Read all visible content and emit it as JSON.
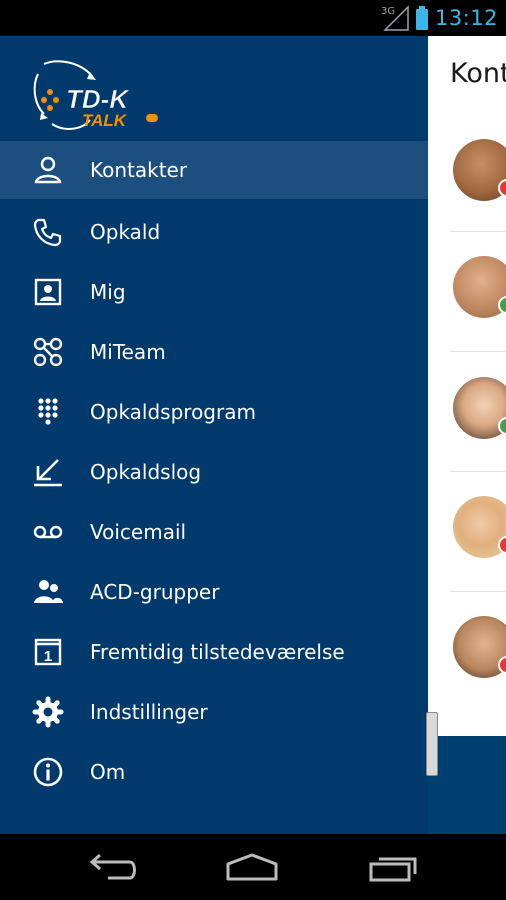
{
  "status_bar": {
    "network": "3G",
    "time": "13:12",
    "accent": "#3db5e6"
  },
  "logo": {
    "line1": "TD-K",
    "line2": "TALK"
  },
  "drawer": {
    "background": "#003a6d",
    "items": [
      {
        "label": "Kontakter",
        "icon": "person-icon",
        "selected": true
      },
      {
        "label": "Opkald",
        "icon": "phone-icon"
      },
      {
        "label": "Mig",
        "icon": "contact-card-icon"
      },
      {
        "label": "MiTeam",
        "icon": "team-nodes-icon"
      },
      {
        "label": "Opkaldsprogram",
        "icon": "dialpad-icon"
      },
      {
        "label": "Opkaldslog",
        "icon": "call-log-icon"
      },
      {
        "label": "Voicemail",
        "icon": "voicemail-icon"
      },
      {
        "label": "ACD-grupper",
        "icon": "group-icon"
      },
      {
        "label": "Fremtidig tilstedeværelse",
        "icon": "calendar-icon"
      },
      {
        "label": "Indstillinger",
        "icon": "gear-icon"
      },
      {
        "label": "Om",
        "icon": "info-icon"
      }
    ]
  },
  "contacts": {
    "title": "Kont",
    "rows": [
      {
        "avatar": "avatar-man-1",
        "status": "busy",
        "status_color": "#e53935"
      },
      {
        "avatar": "avatar-man-2",
        "status": "available",
        "status_color": "#43a047"
      },
      {
        "avatar": "avatar-woman-1",
        "status": "available",
        "status_color": "#43a047"
      },
      {
        "avatar": "avatar-woman-2",
        "status": "busy",
        "status_color": "#e53935"
      },
      {
        "avatar": "avatar-man-3",
        "status": "busy",
        "status_color": "#e53935"
      }
    ]
  },
  "navigation_bar": {
    "buttons": [
      "back-icon",
      "home-icon",
      "recent-apps-icon"
    ]
  }
}
